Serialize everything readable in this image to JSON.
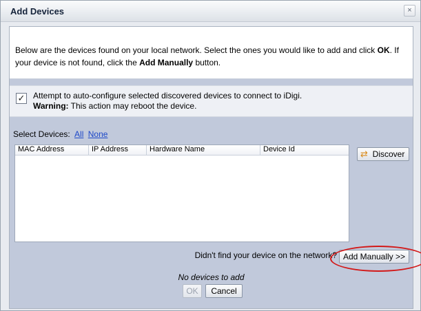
{
  "window": {
    "title": "Add Devices",
    "close_glyph": "×"
  },
  "intro": {
    "text_before_ok": "Below are the devices found on your local network. Select the ones you would like to add and click ",
    "ok_bold": "OK",
    "text_after_ok": ". If your device is not found, click the ",
    "add_manually_bold": "Add Manually",
    "text_end": " button."
  },
  "autoconfig": {
    "checked": true,
    "check_glyph": "✓",
    "label": "Attempt to auto-configure selected discovered devices to connect to iDigi.",
    "warning_bold": "Warning:",
    "warning_text": " This action may reboot the device."
  },
  "select_devices": {
    "label": "Select Devices:",
    "all": "All",
    "none": "None"
  },
  "grid": {
    "columns": [
      "MAC Address",
      "IP Address",
      "Hardware Name",
      "Device Id"
    ],
    "rows": []
  },
  "discover": {
    "label": "Discover",
    "icon": "discover-icon"
  },
  "not_found_text": "Didn't find your device on the network?",
  "add_manually_label": "Add Manually >>",
  "status": "No devices to add",
  "buttons": {
    "ok": "OK",
    "cancel": "Cancel"
  },
  "colors": {
    "panel_bg": "#c1c9db",
    "link": "#1d48c8",
    "highlight_ring": "#d31818"
  }
}
